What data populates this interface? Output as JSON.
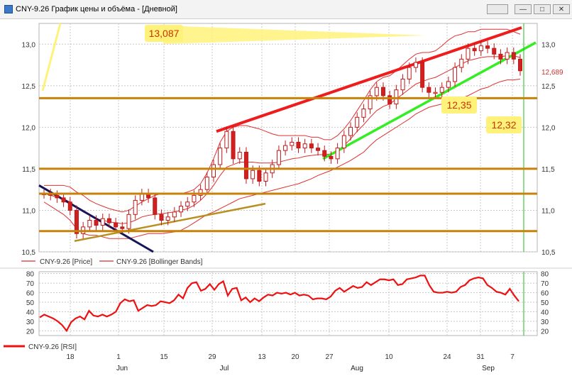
{
  "window": {
    "title": "CNY-9.26 График цены и объёма - [Дневной]",
    "buttons": {
      "extra": "",
      "minimize": "—",
      "maximize": "□",
      "close": "✕"
    }
  },
  "colors": {
    "candle_up": "#ffffff",
    "candle_down": "#d02020",
    "candle_outline": "#c01818",
    "bollinger": "#e03030",
    "rsi": "#ee1111",
    "trend_red": "#ee1c1c",
    "trend_green": "#33ee22",
    "support_brown": "#c8820a",
    "trend_navy": "#15155a",
    "trend_tan": "#b89020",
    "highlight_yellow": "#fff27a",
    "grid": "#c8c8c8"
  },
  "chart_data": [
    {
      "type": "candlestick",
      "ylim": [
        10.5,
        13.25
      ],
      "yticks": [
        10.5,
        11.0,
        11.5,
        12.0,
        12.5,
        13.0
      ],
      "ytick_labels": [
        "10,5",
        "11,0",
        "11,5",
        "12,0",
        "12,5",
        "13,0"
      ],
      "last_price_label": "12,689",
      "last_price": 12.69,
      "x_tick_labels": [
        "18",
        "1",
        "15",
        "29",
        "13",
        "20",
        "27",
        "10",
        "24",
        "31",
        "7"
      ],
      "month_labels": [
        "Jun",
        "Jul",
        "Aug",
        "Sep"
      ],
      "legend": [
        "CNY-9.26 [Price]",
        "CNY-9.26 [Bollinger Bands]"
      ],
      "close": [
        11.2,
        11.18,
        11.15,
        11.1,
        11.0,
        10.72,
        10.8,
        10.88,
        10.82,
        10.9,
        10.85,
        10.8,
        10.78,
        10.95,
        11.12,
        11.2,
        11.15,
        10.95,
        10.88,
        10.92,
        10.98,
        11.05,
        11.1,
        11.18,
        11.25,
        11.4,
        11.55,
        11.75,
        11.95,
        11.62,
        11.7,
        11.38,
        11.48,
        11.35,
        11.45,
        11.55,
        11.72,
        11.78,
        11.82,
        11.75,
        11.8,
        11.75,
        11.72,
        11.65,
        11.62,
        11.75,
        11.9,
        12.0,
        12.12,
        12.22,
        12.38,
        12.48,
        12.38,
        12.28,
        12.45,
        12.58,
        12.72,
        12.78,
        12.48,
        12.42,
        12.42,
        12.48,
        12.55,
        12.72,
        12.82,
        12.95,
        12.92,
        12.98,
        12.95,
        12.88,
        12.82,
        12.9,
        12.82,
        12.68
      ],
      "bollinger_upper": [
        11.3,
        11.3,
        11.3,
        11.3,
        11.28,
        11.22,
        11.18,
        11.12,
        11.08,
        11.05,
        11.02,
        11.0,
        10.98,
        11.0,
        11.05,
        11.1,
        11.14,
        11.18,
        11.2,
        11.2,
        11.2,
        11.2,
        11.22,
        11.25,
        11.32,
        11.45,
        11.62,
        11.82,
        11.95,
        12.0,
        12.02,
        12.02,
        12.0,
        11.98,
        11.95,
        11.92,
        11.9,
        11.9,
        11.9,
        11.9,
        11.9,
        11.88,
        11.88,
        11.85,
        11.85,
        11.9,
        11.98,
        12.08,
        12.2,
        12.32,
        12.45,
        12.55,
        12.6,
        12.62,
        12.68,
        12.75,
        12.82,
        12.88,
        12.9,
        12.9,
        12.92,
        12.98,
        13.05,
        13.1,
        13.12,
        13.15,
        13.15,
        13.18,
        13.18,
        13.18,
        13.18,
        13.18,
        13.15,
        13.12
      ],
      "bollinger_middle": [
        11.2,
        11.18,
        11.16,
        11.14,
        11.1,
        11.04,
        10.98,
        10.94,
        10.9,
        10.88,
        10.86,
        10.85,
        10.84,
        10.85,
        10.88,
        10.92,
        10.94,
        10.95,
        10.96,
        10.97,
        10.98,
        11.0,
        11.02,
        11.06,
        11.12,
        11.2,
        11.3,
        11.42,
        11.52,
        11.55,
        11.58,
        11.58,
        11.58,
        11.57,
        11.57,
        11.57,
        11.58,
        11.6,
        11.62,
        11.63,
        11.65,
        11.66,
        11.67,
        11.67,
        11.68,
        11.72,
        11.78,
        11.86,
        11.95,
        12.03,
        12.12,
        12.2,
        12.25,
        12.28,
        12.34,
        12.4,
        12.46,
        12.52,
        12.55,
        12.58,
        12.6,
        12.64,
        12.68,
        12.72,
        12.76,
        12.8,
        12.82,
        12.84,
        12.85,
        12.85,
        12.85,
        12.86,
        12.86,
        12.84
      ],
      "bollinger_lower": [
        11.1,
        11.05,
        11.0,
        10.95,
        10.88,
        10.78,
        10.72,
        10.7,
        10.7,
        10.68,
        10.66,
        10.66,
        10.66,
        10.66,
        10.68,
        10.7,
        10.72,
        10.72,
        10.72,
        10.73,
        10.74,
        10.76,
        10.8,
        10.85,
        10.9,
        10.95,
        10.98,
        11.02,
        11.06,
        11.1,
        11.14,
        11.16,
        11.18,
        11.2,
        11.22,
        11.24,
        11.26,
        11.28,
        11.3,
        11.32,
        11.35,
        11.38,
        11.42,
        11.45,
        11.48,
        11.52,
        11.56,
        11.6,
        11.65,
        11.7,
        11.78,
        11.85,
        11.9,
        11.95,
        12.0,
        12.05,
        12.1,
        12.16,
        12.2,
        12.24,
        12.26,
        12.28,
        12.3,
        12.32,
        12.35,
        12.38,
        12.42,
        12.46,
        12.48,
        12.52,
        12.55,
        12.57,
        12.57,
        12.58
      ]
    },
    {
      "type": "line",
      "legend": [
        "CNY-9.26 [RSI]"
      ],
      "ylim": [
        15,
        82
      ],
      "yticks": [
        20,
        30,
        40,
        50,
        60,
        70,
        80
      ],
      "ytick_labels": [
        "20",
        "30",
        "40",
        "50",
        "60",
        "70",
        "80"
      ],
      "series": [
        {
          "name": "CNY-9.26 [RSI]",
          "values": [
            34,
            37,
            35,
            33,
            30,
            26,
            20,
            29,
            33,
            35,
            32,
            41,
            36,
            35,
            37,
            35,
            37,
            40,
            49,
            53,
            51,
            52,
            41,
            44,
            47,
            46,
            47,
            51,
            50,
            49,
            52,
            58,
            54,
            65,
            70,
            71,
            62,
            64,
            69,
            63,
            69,
            72,
            57,
            64,
            65,
            52,
            55,
            50,
            54,
            51,
            55,
            58,
            57,
            60,
            59,
            60,
            58,
            60,
            57,
            58,
            57,
            53,
            54,
            54,
            53,
            56,
            62,
            65,
            61,
            64,
            67,
            65,
            66,
            71,
            68,
            71,
            74,
            74,
            73,
            74,
            68,
            69,
            74,
            75,
            76,
            78,
            78,
            68,
            61,
            60,
            60,
            61,
            60,
            61,
            66,
            68,
            73,
            75,
            76,
            75,
            68,
            65,
            61,
            60,
            58,
            64,
            57,
            51
          ]
        }
      ]
    }
  ],
  "annotations": {
    "price_label_1": "13,087",
    "price_label_2": "12,35",
    "price_label_3": "12,32"
  }
}
